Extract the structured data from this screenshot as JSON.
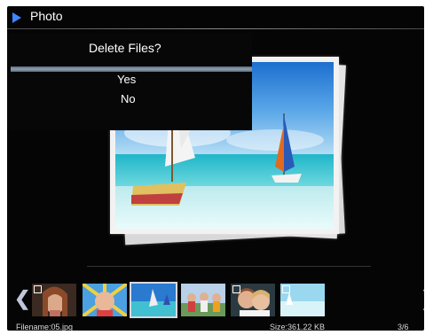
{
  "header": {
    "title": "Photo",
    "icon": "play-arrow-icon",
    "accent": "#3f86ff"
  },
  "dialog": {
    "title": "Delete Files?",
    "options": [
      "Yes",
      "No"
    ],
    "selected": "Yes"
  },
  "viewer": {
    "image": "sailboat-beach-photo"
  },
  "thumbnails": [
    {
      "icon": "woman-portrait-thumbnail",
      "selected": false,
      "checkbox": true
    },
    {
      "icon": "child-portrait-thumbnail",
      "selected": false,
      "checkbox": false
    },
    {
      "icon": "sailboat-thumbnail",
      "selected": true,
      "checkbox": false
    },
    {
      "icon": "group-people-thumbnail",
      "selected": false,
      "checkbox": false
    },
    {
      "icon": "couple-portrait-thumbnail",
      "selected": false,
      "checkbox": true
    },
    {
      "icon": "beach-scene-thumbnail",
      "selected": false,
      "checkbox": true
    }
  ],
  "status": {
    "filename": "Filename:05.jpg",
    "size": "Size:361.22 KB",
    "counter": "3/6"
  }
}
